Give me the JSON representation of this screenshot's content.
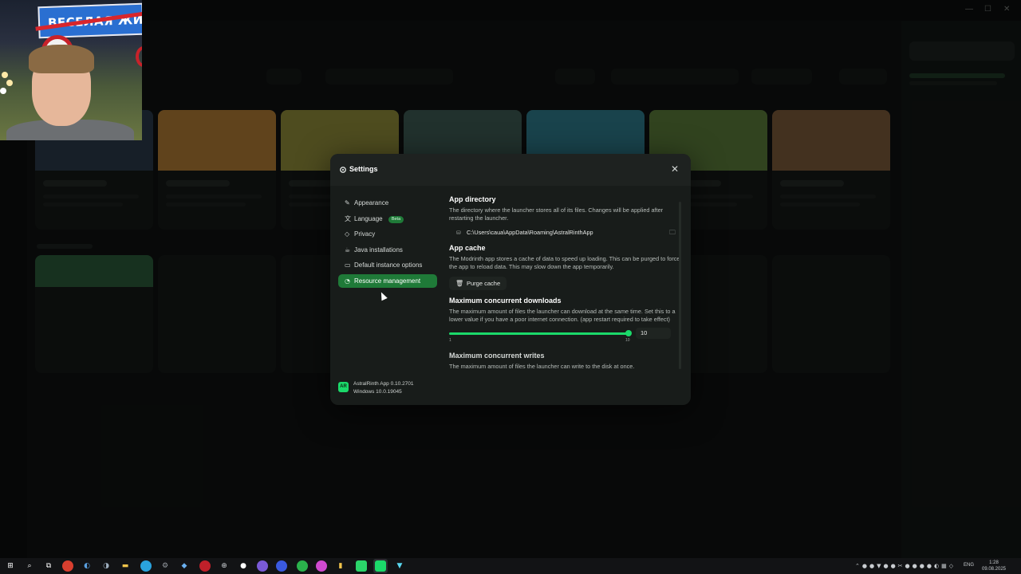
{
  "webcam": {
    "sign_text": "ВЕСЕЛАЯ ЖИЗ"
  },
  "dialog": {
    "title": "Settings",
    "close_icon": "close-icon",
    "nav": [
      {
        "label": "Appearance",
        "icon": "brush-icon"
      },
      {
        "label": "Language",
        "icon": "language-icon",
        "badge": "Beta"
      },
      {
        "label": "Privacy",
        "icon": "shield-icon"
      },
      {
        "label": "Java installations",
        "icon": "coffee-icon"
      },
      {
        "label": "Default instance options",
        "icon": "window-icon"
      },
      {
        "label": "Resource management",
        "icon": "gauge-icon",
        "active": true
      }
    ],
    "app_info": {
      "name": "AstralRinth App 0.10.2701",
      "os": "Windows 10.0.19045",
      "logo_text": "AR"
    },
    "sections": {
      "app_directory": {
        "title": "App directory",
        "description": "The directory where the launcher stores all of its files. Changes will be applied after restarting the launcher.",
        "path": "C:\\Users\\caua\\AppData\\Roaming\\AstralRinthApp"
      },
      "app_cache": {
        "title": "App cache",
        "description": "The Modrinth app stores a cache of data to speed up loading. This can be purged to force the app to reload data. This may slow down the app temporarily.",
        "button": "Purge cache"
      },
      "max_downloads": {
        "title": "Maximum concurrent downloads",
        "description": "The maximum amount of files the launcher can download at the same time. Set this to a lower value if you have a poor internet connection. (app restart required to take effect)",
        "slider_min": "1",
        "slider_max": "10",
        "value": "10"
      },
      "max_writes": {
        "title": "Maximum concurrent writes",
        "description": "The maximum amount of files the launcher can write to the disk at once."
      }
    }
  },
  "taskbar": {
    "lang": "ENG",
    "time": "1:28",
    "date": "09.08.2025"
  },
  "colors": {
    "accent": "#1bd96a",
    "active_nav": "#1f7a38",
    "dialog_bg": "#181c1a"
  }
}
